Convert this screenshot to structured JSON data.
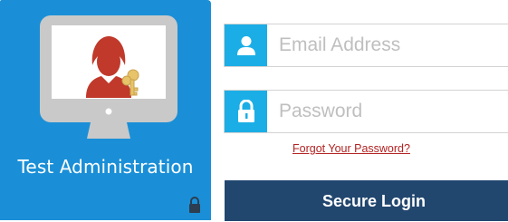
{
  "tile": {
    "label": "Test Administration",
    "icon": "admin-monitor-icon",
    "lock_icon": "lock-icon",
    "color": "#1a8fd7"
  },
  "login": {
    "email_placeholder": "Email Address",
    "email_value": "",
    "email_icon": "user-icon",
    "password_placeholder": "Password",
    "password_value": "",
    "password_icon": "lock-icon",
    "forgot_link": "Forgot Your Password?",
    "submit_label": "Secure Login",
    "accent_color": "#1baee6",
    "button_color": "#22476f",
    "link_color": "#b22222"
  }
}
